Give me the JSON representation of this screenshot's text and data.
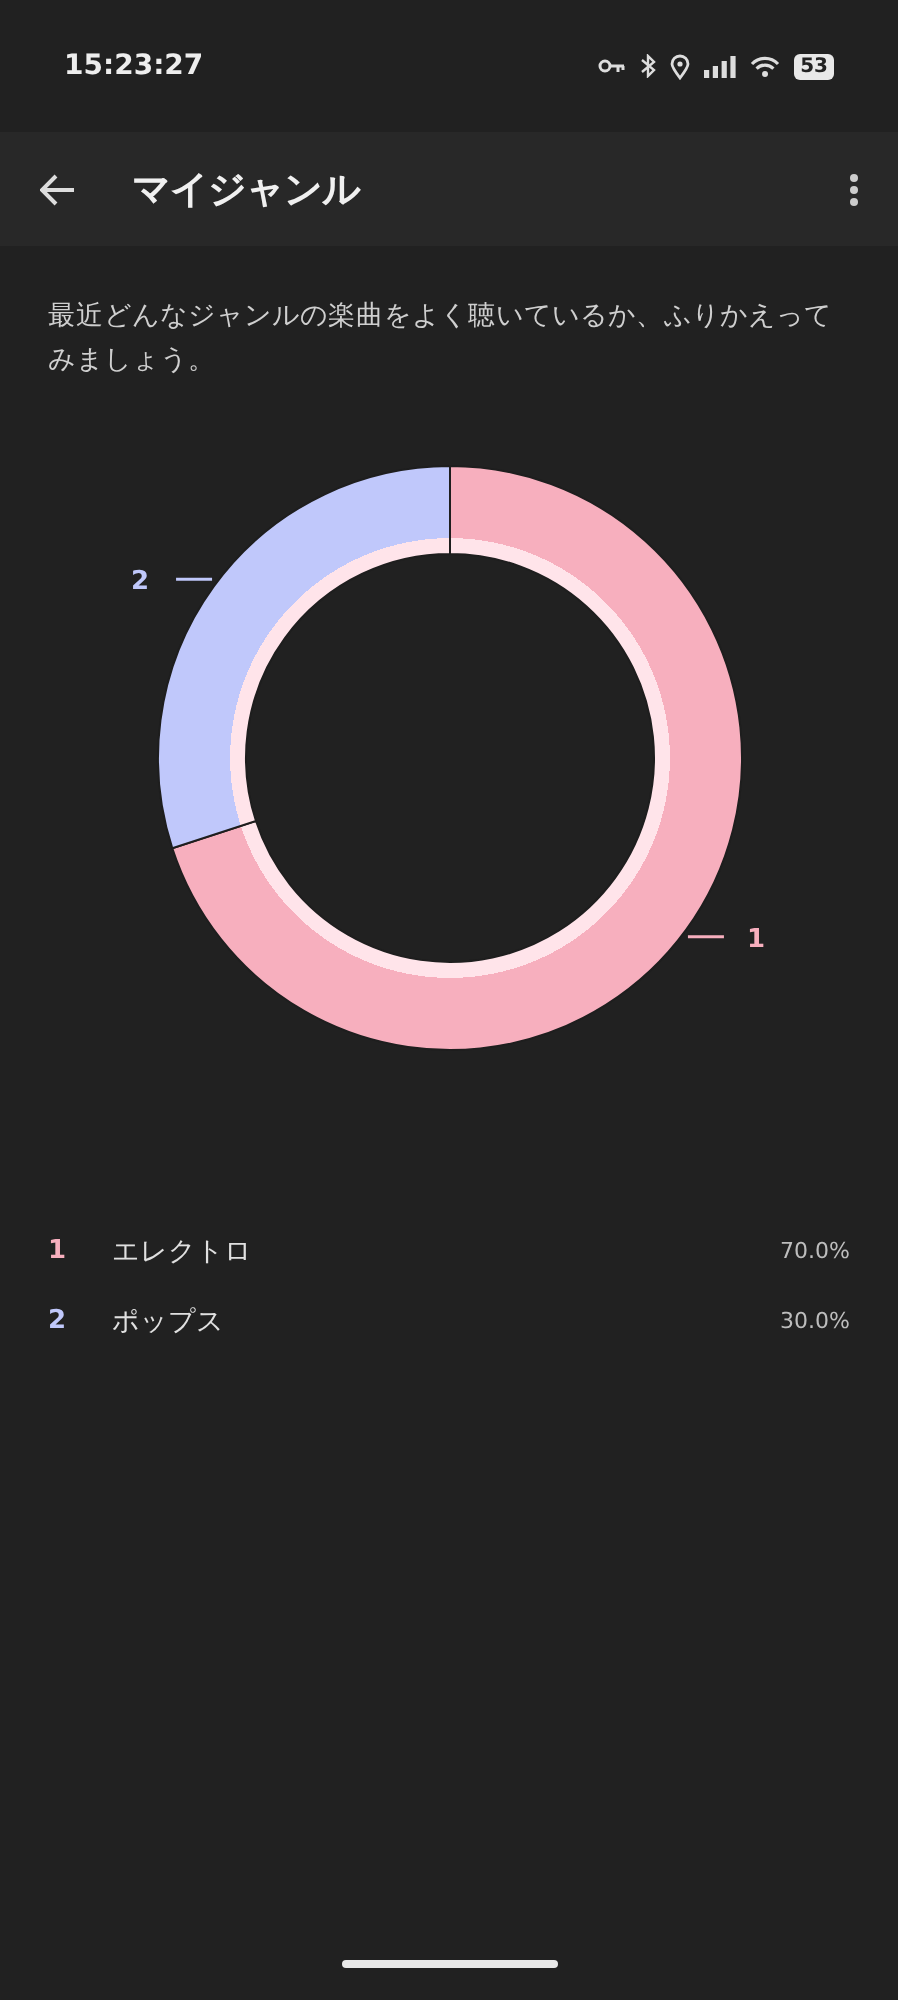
{
  "status_bar": {
    "time": "15:23:27",
    "battery": "53"
  },
  "app_bar": {
    "title": "マイジャンル"
  },
  "description": "最近どんなジャンルの楽曲をよく聴いているか、ふりかえってみましょう。",
  "chart_data": {
    "type": "donut",
    "categories": [
      "1",
      "2"
    ],
    "values": [
      70,
      30
    ]
  },
  "legend": [
    {
      "rank": "1",
      "name": "エレクトロ",
      "percent": "70.0%",
      "color": "#f7afbe"
    },
    {
      "rank": "2",
      "name": "ポップス",
      "percent": "30.0%",
      "color": "#c0c8fb"
    }
  ]
}
